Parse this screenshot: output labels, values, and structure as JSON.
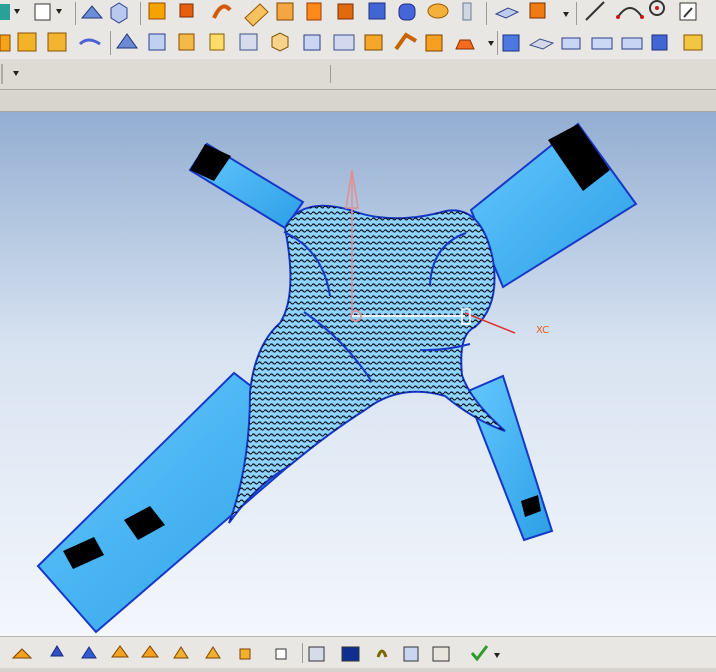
{
  "viewport": {
    "axis_label_xc": "XC"
  },
  "colors": {
    "viewport_top": "#93aed2",
    "viewport_bottom": "#f4f7fc",
    "surface_fill": "#3fb7f3",
    "edge_lines": "#1638c8",
    "wcs_x_axis": "#e06020",
    "wcs_z_axis": "#e09090"
  },
  "toolbar": {
    "top_row_icons": [
      "point-icon",
      "datum-plane-icon",
      "shade-icon",
      "view-cube-icon",
      "box-icon",
      "extrude-icon",
      "sweep-icon",
      "mesh-icon",
      "fill-icon",
      "offset-icon",
      "block-icon",
      "body-icon",
      "cylinder-icon",
      "lens-icon",
      "spring-icon",
      "plate-icon",
      "pattern-icon",
      "line-icon",
      "arc-icon",
      "circle-icon",
      "sketch-icon"
    ],
    "second_row_icons": [
      "blend-icon",
      "face-icon",
      "surface-icon",
      "fill-icon",
      "boundary-icon",
      "trim-icon",
      "section-icon",
      "ruled-icon",
      "through-curves-icon",
      "book-icon",
      "extract-icon",
      "thicken-icon",
      "flange-icon",
      "lift-icon",
      "cube-icon",
      "split-face-icon",
      "stack-icon",
      "box-body-icon",
      "cuboid-icon",
      "unite-icon",
      "move-face-icon"
    ],
    "bottom_row_icons": [
      "add-point-icon",
      "mirror-icon",
      "transform-icon",
      "pattern-feature-icon",
      "copy-body-icon",
      "boolean-icon",
      "move-icon",
      "assembly-icon",
      "constraint-icon",
      "frame-icon",
      "chain-icon",
      "view-icon",
      "link-icon",
      "info-icon",
      "check-icon"
    ]
  }
}
